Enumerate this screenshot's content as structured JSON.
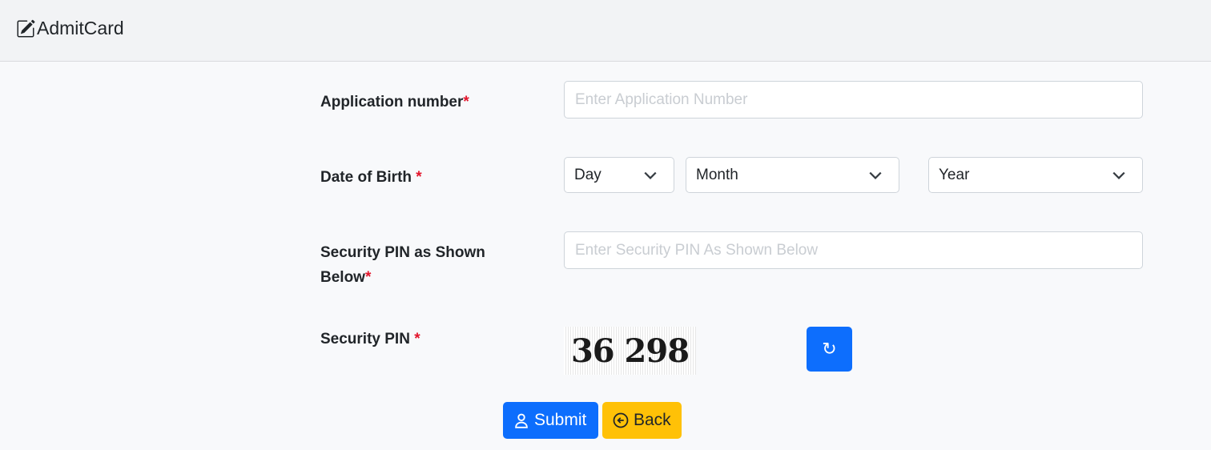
{
  "header": {
    "brand_icon": "edit-icon",
    "title": "AdmitCard"
  },
  "form": {
    "application_number": {
      "label": "Application number",
      "required_mark": "*",
      "placeholder": "Enter Application Number",
      "value": ""
    },
    "dob": {
      "label": "Date of Birth ",
      "required_mark": "*",
      "day": "Day",
      "month": "Month",
      "year": "Year"
    },
    "security_pin_input": {
      "label_line1": "Security PIN as Shown",
      "label_line2": "Below",
      "required_mark": "*",
      "placeholder": "Enter Security PIN As Shown Below",
      "value": ""
    },
    "security_pin": {
      "label": "Security PIN ",
      "required_mark": "*",
      "captcha_text": "36 298",
      "refresh_icon": "refresh-icon",
      "refresh_glyph": "↻"
    }
  },
  "actions": {
    "submit_label": "Submit",
    "submit_icon": "user-icon",
    "back_label": "Back",
    "back_icon": "arrow-left-circle-icon"
  },
  "colors": {
    "primary": "#0d6efd",
    "warning": "#ffc107",
    "required": "#e3152b"
  }
}
